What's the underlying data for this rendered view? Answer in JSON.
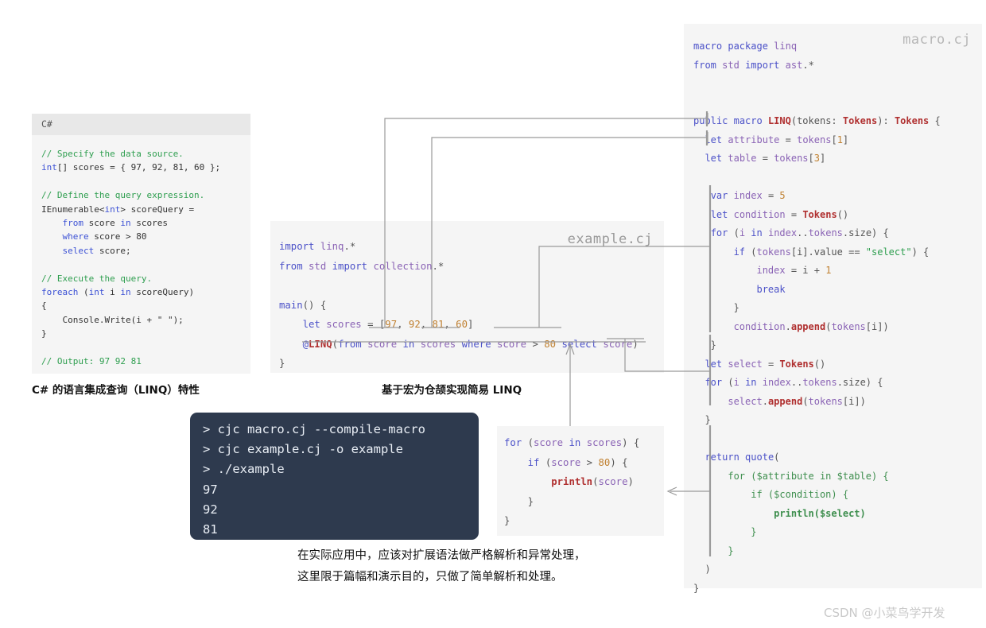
{
  "csharp_panel": {
    "header_label": "C#",
    "lines": [
      [
        {
          "t": "// Specify the data source.",
          "c": "cs-cm"
        }
      ],
      [
        {
          "t": "int",
          "c": "cs-kw"
        },
        {
          "t": "[] scores = { 97, 92, 81, 60 };",
          "c": "cs-tx"
        }
      ],
      [
        {
          "t": " ",
          "c": "cs-tx"
        }
      ],
      [
        {
          "t": "// Define the query expression.",
          "c": "cs-cm"
        }
      ],
      [
        {
          "t": "IEnumerable<",
          "c": "cs-tx"
        },
        {
          "t": "int",
          "c": "cs-kw"
        },
        {
          "t": "> scoreQuery =",
          "c": "cs-tx"
        }
      ],
      [
        {
          "t": "    ",
          "c": "cs-tx"
        },
        {
          "t": "from",
          "c": "cs-kw"
        },
        {
          "t": " score ",
          "c": "cs-tx"
        },
        {
          "t": "in",
          "c": "cs-kw"
        },
        {
          "t": " scores",
          "c": "cs-tx"
        }
      ],
      [
        {
          "t": "    ",
          "c": "cs-tx"
        },
        {
          "t": "where",
          "c": "cs-kw"
        },
        {
          "t": " score > 80",
          "c": "cs-tx"
        }
      ],
      [
        {
          "t": "    ",
          "c": "cs-tx"
        },
        {
          "t": "select",
          "c": "cs-kw"
        },
        {
          "t": " score;",
          "c": "cs-tx"
        }
      ],
      [
        {
          "t": " ",
          "c": "cs-tx"
        }
      ],
      [
        {
          "t": "// Execute the query.",
          "c": "cs-cm"
        }
      ],
      [
        {
          "t": "foreach",
          "c": "cs-kw"
        },
        {
          "t": " (",
          "c": "cs-tx"
        },
        {
          "t": "int",
          "c": "cs-kw"
        },
        {
          "t": " i ",
          "c": "cs-tx"
        },
        {
          "t": "in",
          "c": "cs-kw"
        },
        {
          "t": " scoreQuery)",
          "c": "cs-tx"
        }
      ],
      [
        {
          "t": "{",
          "c": "cs-tx"
        }
      ],
      [
        {
          "t": "    Console.Write(i + \" \");",
          "c": "cs-tx"
        }
      ],
      [
        {
          "t": "}",
          "c": "cs-tx"
        }
      ],
      [
        {
          "t": " ",
          "c": "cs-tx"
        }
      ],
      [
        {
          "t": "// Output: 97 92 81",
          "c": "cs-cm"
        }
      ]
    ]
  },
  "example_panel": {
    "title": "example.cj",
    "lines": [
      [
        {
          "t": "import",
          "c": "kw"
        },
        {
          "t": " ",
          "c": "pl"
        },
        {
          "t": "linq",
          "c": "id"
        },
        {
          "t": ".*",
          "c": "pl"
        }
      ],
      [
        {
          "t": "from",
          "c": "kw"
        },
        {
          "t": " ",
          "c": "pl"
        },
        {
          "t": "std",
          "c": "id"
        },
        {
          "t": " ",
          "c": "pl"
        },
        {
          "t": "import",
          "c": "kw"
        },
        {
          "t": " ",
          "c": "pl"
        },
        {
          "t": "collection",
          "c": "id"
        },
        {
          "t": ".*",
          "c": "pl"
        }
      ],
      [
        {
          "t": " ",
          "c": "pl"
        }
      ],
      [
        {
          "t": "main",
          "c": "kw"
        },
        {
          "t": "() {",
          "c": "pl"
        }
      ],
      [
        {
          "t": "    ",
          "c": "pl"
        },
        {
          "t": "let",
          "c": "kw"
        },
        {
          "t": " ",
          "c": "pl"
        },
        {
          "t": "scores",
          "c": "id"
        },
        {
          "t": " = [",
          "c": "pl"
        },
        {
          "t": "97",
          "c": "num"
        },
        {
          "t": ", ",
          "c": "pl"
        },
        {
          "t": "92",
          "c": "num"
        },
        {
          "t": ", ",
          "c": "pl"
        },
        {
          "t": "81",
          "c": "num"
        },
        {
          "t": ", ",
          "c": "pl"
        },
        {
          "t": "60",
          "c": "num"
        },
        {
          "t": "]",
          "c": "pl"
        }
      ],
      [
        {
          "t": "    ",
          "c": "pl"
        },
        {
          "t": "@",
          "c": "kw"
        },
        {
          "t": "LINQ",
          "c": "ty"
        },
        {
          "t": "(",
          "c": "pl"
        },
        {
          "t": "from",
          "c": "kw"
        },
        {
          "t": " ",
          "c": "pl"
        },
        {
          "t": "score",
          "c": "id"
        },
        {
          "t": " ",
          "c": "pl"
        },
        {
          "t": "in",
          "c": "kw"
        },
        {
          "t": " ",
          "c": "pl"
        },
        {
          "t": "scores",
          "c": "id"
        },
        {
          "t": " ",
          "c": "pl"
        },
        {
          "t": "where",
          "c": "kw"
        },
        {
          "t": " ",
          "c": "pl"
        },
        {
          "t": "score",
          "c": "id"
        },
        {
          "t": " > ",
          "c": "pl"
        },
        {
          "t": "80",
          "c": "num"
        },
        {
          "t": " ",
          "c": "pl"
        },
        {
          "t": "select",
          "c": "kw"
        },
        {
          "t": " ",
          "c": "pl"
        },
        {
          "t": "score",
          "c": "id"
        },
        {
          "t": ")",
          "c": "pl"
        }
      ],
      [
        {
          "t": "}",
          "c": "pl"
        }
      ]
    ]
  },
  "macro_panel": {
    "title": "macro.cj",
    "lines": [
      [
        {
          "t": "macro",
          "c": "kw"
        },
        {
          "t": " ",
          "c": "pl"
        },
        {
          "t": "package",
          "c": "kw"
        },
        {
          "t": " ",
          "c": "pl"
        },
        {
          "t": "linq",
          "c": "id"
        }
      ],
      [
        {
          "t": "from",
          "c": "kw"
        },
        {
          "t": " ",
          "c": "pl"
        },
        {
          "t": "std",
          "c": "id"
        },
        {
          "t": " ",
          "c": "pl"
        },
        {
          "t": "import",
          "c": "kw"
        },
        {
          "t": " ",
          "c": "pl"
        },
        {
          "t": "ast",
          "c": "id"
        },
        {
          "t": ".*",
          "c": "pl"
        }
      ],
      [
        {
          "t": " ",
          "c": "pl"
        }
      ],
      [
        {
          "t": " ",
          "c": "pl"
        }
      ],
      [
        {
          "t": "public",
          "c": "kw"
        },
        {
          "t": " ",
          "c": "pl"
        },
        {
          "t": "macro",
          "c": "kw"
        },
        {
          "t": " ",
          "c": "pl"
        },
        {
          "t": "LINQ",
          "c": "ty"
        },
        {
          "t": "(tokens: ",
          "c": "pl"
        },
        {
          "t": "Tokens",
          "c": "ty"
        },
        {
          "t": "): ",
          "c": "pl"
        },
        {
          "t": "Tokens",
          "c": "ty"
        },
        {
          "t": " {",
          "c": "pl"
        }
      ],
      [
        {
          "t": "  ",
          "c": "pl"
        },
        {
          "t": "let",
          "c": "kw"
        },
        {
          "t": " ",
          "c": "pl"
        },
        {
          "t": "attribute",
          "c": "id"
        },
        {
          "t": " = ",
          "c": "pl"
        },
        {
          "t": "tokens",
          "c": "id"
        },
        {
          "t": "[",
          "c": "pl"
        },
        {
          "t": "1",
          "c": "num"
        },
        {
          "t": "]",
          "c": "pl"
        }
      ],
      [
        {
          "t": "  ",
          "c": "pl"
        },
        {
          "t": "let",
          "c": "kw"
        },
        {
          "t": " ",
          "c": "pl"
        },
        {
          "t": "table",
          "c": "id"
        },
        {
          "t": " = ",
          "c": "pl"
        },
        {
          "t": "tokens",
          "c": "id"
        },
        {
          "t": "[",
          "c": "pl"
        },
        {
          "t": "3",
          "c": "num"
        },
        {
          "t": "]",
          "c": "pl"
        }
      ],
      [
        {
          "t": " ",
          "c": "pl"
        }
      ],
      [
        {
          "t": "   ",
          "c": "pl"
        },
        {
          "t": "var",
          "c": "kw"
        },
        {
          "t": " ",
          "c": "pl"
        },
        {
          "t": "index",
          "c": "id"
        },
        {
          "t": " = ",
          "c": "pl"
        },
        {
          "t": "5",
          "c": "num"
        }
      ],
      [
        {
          "t": "   ",
          "c": "pl"
        },
        {
          "t": "let",
          "c": "kw"
        },
        {
          "t": " ",
          "c": "pl"
        },
        {
          "t": "condition",
          "c": "id"
        },
        {
          "t": " = ",
          "c": "pl"
        },
        {
          "t": "Tokens",
          "c": "ty"
        },
        {
          "t": "()",
          "c": "pl"
        }
      ],
      [
        {
          "t": "   ",
          "c": "pl"
        },
        {
          "t": "for",
          "c": "kw"
        },
        {
          "t": " (",
          "c": "pl"
        },
        {
          "t": "i",
          "c": "id"
        },
        {
          "t": " ",
          "c": "pl"
        },
        {
          "t": "in",
          "c": "kw"
        },
        {
          "t": " ",
          "c": "pl"
        },
        {
          "t": "index",
          "c": "id"
        },
        {
          "t": "..",
          "c": "pl"
        },
        {
          "t": "tokens",
          "c": "id"
        },
        {
          "t": ".size) {",
          "c": "pl"
        }
      ],
      [
        {
          "t": "       ",
          "c": "pl"
        },
        {
          "t": "if",
          "c": "kw"
        },
        {
          "t": " (",
          "c": "pl"
        },
        {
          "t": "tokens",
          "c": "id"
        },
        {
          "t": "[i].value == ",
          "c": "pl"
        },
        {
          "t": "\"select\"",
          "c": "str"
        },
        {
          "t": ") {",
          "c": "pl"
        }
      ],
      [
        {
          "t": "           ",
          "c": "pl"
        },
        {
          "t": "index",
          "c": "id"
        },
        {
          "t": " = i + ",
          "c": "pl"
        },
        {
          "t": "1",
          "c": "num"
        }
      ],
      [
        {
          "t": "           ",
          "c": "pl"
        },
        {
          "t": "break",
          "c": "kw"
        }
      ],
      [
        {
          "t": "       }",
          "c": "pl"
        }
      ],
      [
        {
          "t": "       ",
          "c": "pl"
        },
        {
          "t": "condition",
          "c": "id"
        },
        {
          "t": ".",
          "c": "pl"
        },
        {
          "t": "append",
          "c": "fn"
        },
        {
          "t": "(",
          "c": "pl"
        },
        {
          "t": "tokens",
          "c": "id"
        },
        {
          "t": "[i])",
          "c": "pl"
        }
      ],
      [
        {
          "t": "   }",
          "c": "pl"
        }
      ],
      [
        {
          "t": "  ",
          "c": "pl"
        },
        {
          "t": "let",
          "c": "kw"
        },
        {
          "t": " ",
          "c": "pl"
        },
        {
          "t": "select",
          "c": "id"
        },
        {
          "t": " = ",
          "c": "pl"
        },
        {
          "t": "Tokens",
          "c": "ty"
        },
        {
          "t": "()",
          "c": "pl"
        }
      ],
      [
        {
          "t": "  ",
          "c": "pl"
        },
        {
          "t": "for",
          "c": "kw"
        },
        {
          "t": " (",
          "c": "pl"
        },
        {
          "t": "i",
          "c": "id"
        },
        {
          "t": " ",
          "c": "pl"
        },
        {
          "t": "in",
          "c": "kw"
        },
        {
          "t": " ",
          "c": "pl"
        },
        {
          "t": "index",
          "c": "id"
        },
        {
          "t": "..",
          "c": "pl"
        },
        {
          "t": "tokens",
          "c": "id"
        },
        {
          "t": ".size) {",
          "c": "pl"
        }
      ],
      [
        {
          "t": "      ",
          "c": "pl"
        },
        {
          "t": "select",
          "c": "id"
        },
        {
          "t": ".",
          "c": "pl"
        },
        {
          "t": "append",
          "c": "fn"
        },
        {
          "t": "(",
          "c": "pl"
        },
        {
          "t": "tokens",
          "c": "id"
        },
        {
          "t": "[i])",
          "c": "pl"
        }
      ],
      [
        {
          "t": "  }",
          "c": "pl"
        }
      ],
      [
        {
          "t": " ",
          "c": "pl"
        }
      ],
      [
        {
          "t": "  ",
          "c": "pl"
        },
        {
          "t": "return",
          "c": "kw"
        },
        {
          "t": " ",
          "c": "pl"
        },
        {
          "t": "quote",
          "c": "kw"
        },
        {
          "t": "(",
          "c": "pl"
        }
      ],
      [
        {
          "t": "      ",
          "c": "pl"
        },
        {
          "t": "for ($attribute in $table) {",
          "c": "gr"
        }
      ],
      [
        {
          "t": "          ",
          "c": "pl"
        },
        {
          "t": "if ($condition) {",
          "c": "gr"
        }
      ],
      [
        {
          "t": "              ",
          "c": "pl"
        },
        {
          "t": "println($select)",
          "c": "gr-b"
        }
      ],
      [
        {
          "t": "          ",
          "c": "pl"
        },
        {
          "t": "}",
          "c": "gr"
        }
      ],
      [
        {
          "t": "      ",
          "c": "pl"
        },
        {
          "t": "}",
          "c": "gr"
        }
      ],
      [
        {
          "t": "  )",
          "c": "pl"
        }
      ],
      [
        {
          "t": "}",
          "c": "pl"
        }
      ]
    ]
  },
  "expanded_panel": {
    "lines": [
      [
        {
          "t": "for",
          "c": "kw"
        },
        {
          "t": " (",
          "c": "pl"
        },
        {
          "t": "score",
          "c": "id"
        },
        {
          "t": " ",
          "c": "pl"
        },
        {
          "t": "in",
          "c": "kw"
        },
        {
          "t": " ",
          "c": "pl"
        },
        {
          "t": "scores",
          "c": "id"
        },
        {
          "t": ") {",
          "c": "pl"
        }
      ],
      [
        {
          "t": "    ",
          "c": "pl"
        },
        {
          "t": "if",
          "c": "kw"
        },
        {
          "t": " (",
          "c": "pl"
        },
        {
          "t": "score",
          "c": "id"
        },
        {
          "t": " > ",
          "c": "pl"
        },
        {
          "t": "80",
          "c": "num"
        },
        {
          "t": ") {",
          "c": "pl"
        }
      ],
      [
        {
          "t": "        ",
          "c": "pl"
        },
        {
          "t": "println",
          "c": "fn"
        },
        {
          "t": "(",
          "c": "pl"
        },
        {
          "t": "score",
          "c": "id"
        },
        {
          "t": ")",
          "c": "pl"
        }
      ],
      [
        {
          "t": "    }",
          "c": "pl"
        }
      ],
      [
        {
          "t": "}",
          "c": "pl"
        }
      ]
    ]
  },
  "terminal": {
    "lines": [
      "> cjc macro.cj --compile-macro",
      "> cjc example.cj -o example",
      "> ./example",
      "97",
      "92",
      "81"
    ]
  },
  "captions": {
    "csharp": "C# 的语言集成查询（LINQ）特性",
    "example": "基于宏为仓颉实现简易 LINQ",
    "note": "在实际应用中，应该对扩展语法做严格解析和异常处理，\n这里限于篇幅和演示目的，只做了简单解析和处理。"
  },
  "watermark": "CSDN @小菜鸟学开发",
  "colors": {
    "panel_bg": "#f5f5f5",
    "csharp_header_bg": "#e8e8e8",
    "terminal_bg": "#2e3a4e",
    "wire": "#9a9a9a",
    "keyword": "#4b51c8",
    "identifier": "#8a63b5",
    "type": "#b03030",
    "number": "#c08030",
    "string": "#2e9e4f",
    "quote_green": "#3f8f4f"
  }
}
